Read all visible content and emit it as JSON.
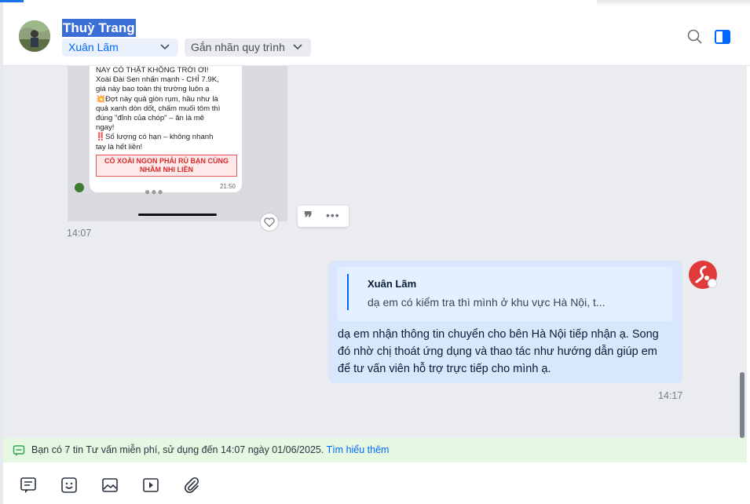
{
  "header": {
    "contact_name": "Thuỳ Trang",
    "agent": "Xuân Lãm",
    "tag_placeholder": "Gắn nhãn quy trình"
  },
  "image_message": {
    "lines": [
      "NAY CÓ THẬT KHÔNG TRỜI ƠI!",
      "Xoài Đài Sen nhấn mạnh - CHỈ 7.9K,",
      "giá này bao toàn thị trường luôn ạ",
      "💥Đợt này quả giòn rụm, hầu như là",
      "quả xanh dòn dốt, chấm muối tôm thì",
      "đúng \"đỉnh của chóp\" – ăn là mê",
      "ngay!",
      "‼️Số lượng có hạn – không nhanh",
      "tay là hết liền!"
    ],
    "cta": "CÓ XOÀI NGON PHẢI RỦ BẠN CÙNG NHÂM NHI LIỀN",
    "inner_time": "21:50",
    "time": "14:07"
  },
  "reply_message": {
    "quoted_name": "Xuân Lãm",
    "quoted_text": "dạ em có kiểm tra thì mình ở khu vực Hà Nội, t...",
    "body": "dạ em nhận thông tin chuyển cho bên Hà Nội tiếp nhận ạ. Song đó nhờ chị thoát ứng dụng và thao tác như hướng dẫn giúp em để tư vấn viên hỗ trợ trực tiếp cho mình ạ.",
    "time": "14:17"
  },
  "notice": {
    "text": "Bạn có 7 tin Tư vấn miễn phí, sử dụng đến 14:07 ngày 01/06/2025.",
    "link": "Tìm hiểu thêm"
  },
  "colors": {
    "accent": "#0068ff",
    "chat_bg": "#ebecf0",
    "my_bubble": "#d8e7fc",
    "notice_bg": "#e6f7e2"
  },
  "toolbar_icons": [
    "note-icon",
    "sticker-icon",
    "image-icon",
    "video-icon",
    "attachment-icon"
  ]
}
